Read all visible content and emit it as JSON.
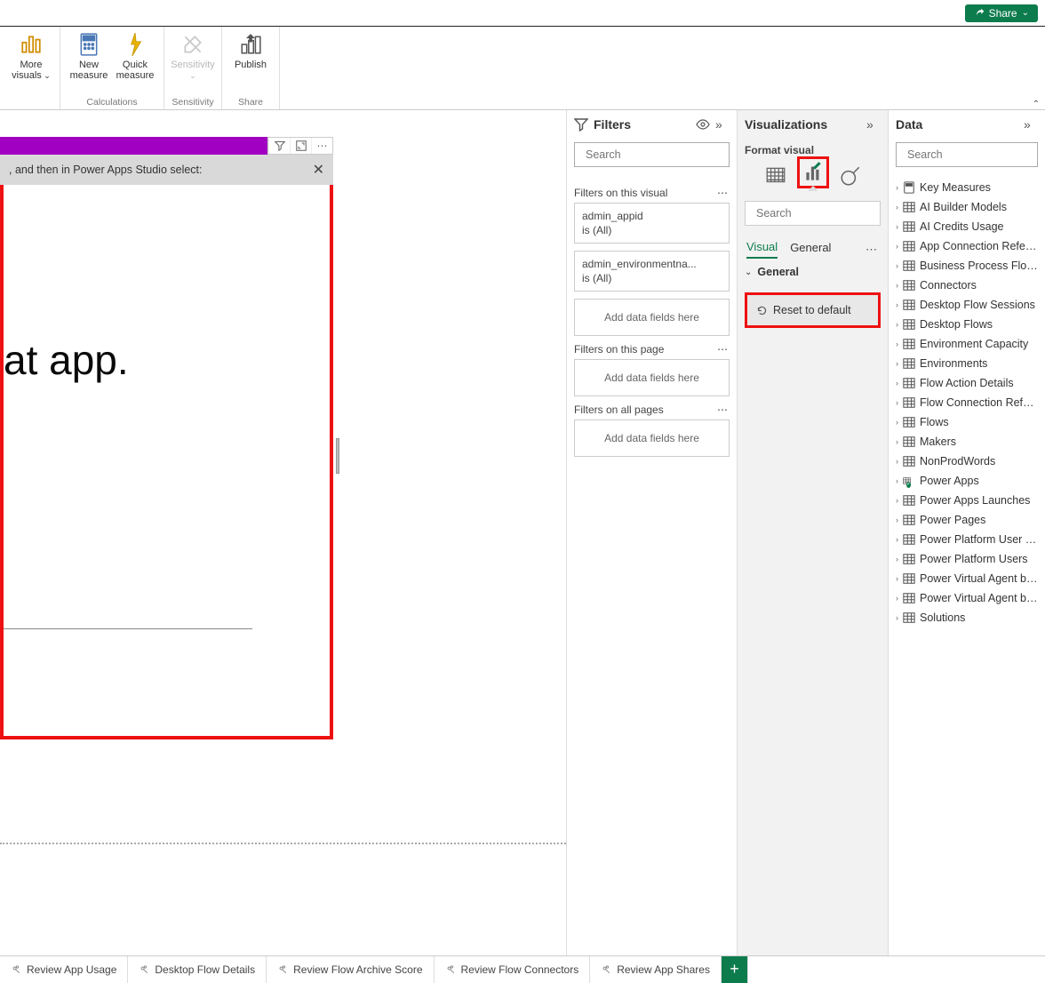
{
  "topbar": {
    "share": "Share"
  },
  "ribbon": {
    "items": [
      {
        "label": "More\nvisuals"
      },
      {
        "label": "New\nmeasure"
      },
      {
        "label": "Quick\nmeasure"
      },
      {
        "label": "Sensitivity"
      },
      {
        "label": "Publish"
      }
    ],
    "groups": [
      "",
      "Calculations",
      "Sensitivity",
      "Share"
    ]
  },
  "canvas": {
    "banner_text": ", and then in Power Apps Studio select:",
    "big_text": "at app.",
    "icon_filter_tip": "Filter",
    "icon_focus_tip": "Focus",
    "icon_more_tip": "More"
  },
  "filters": {
    "title": "Filters",
    "search_placeholder": "Search",
    "sections": {
      "visual_h": "Filters on this visual",
      "page_h": "Filters on this page",
      "all_h": "Filters on all pages",
      "drop": "Add data fields here"
    },
    "cards": [
      {
        "name": "admin_appid",
        "state": "is (All)"
      },
      {
        "name": "admin_environmentna...",
        "state": "is (All)"
      }
    ]
  },
  "viz": {
    "title": "Visualizations",
    "subhead": "Format visual",
    "search_placeholder": "Search",
    "tabs": {
      "visual": "Visual",
      "general": "General"
    },
    "general_group": "General",
    "reset": "Reset to default"
  },
  "data": {
    "title": "Data",
    "search_placeholder": "Search",
    "tables": [
      "Key Measures",
      "AI Builder Models",
      "AI Credits Usage",
      "App Connection Refere...",
      "Business Process Flows",
      "Connectors",
      "Desktop Flow Sessions",
      "Desktop Flows",
      "Environment Capacity",
      "Environments",
      "Flow Action Details",
      "Flow Connection Refer...",
      "Flows",
      "Makers",
      "NonProdWords",
      "Power Apps",
      "Power Apps Launches",
      "Power Pages",
      "Power Platform User Ro...",
      "Power Platform Users",
      "Power Virtual Agent bots",
      "Power Virtual Agent bo...",
      "Solutions"
    ]
  },
  "bottom_tabs": [
    "Review App Usage",
    "Desktop Flow Details",
    "Review Flow Archive Score",
    "Review Flow Connectors",
    "Review App Shares"
  ]
}
